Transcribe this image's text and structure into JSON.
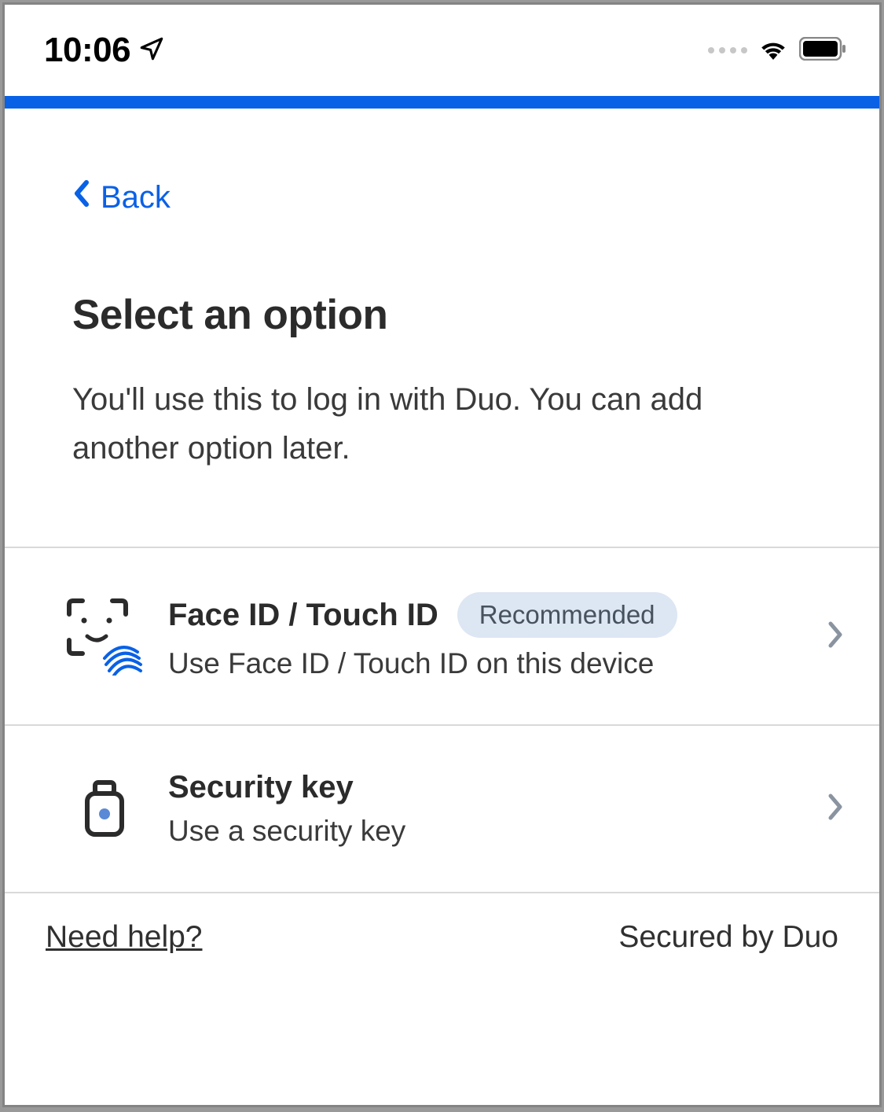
{
  "status_bar": {
    "time": "10:06"
  },
  "nav": {
    "back_label": "Back"
  },
  "header": {
    "title": "Select an option",
    "subtitle": "You'll use this to log in with Duo. You can add another option later."
  },
  "options": [
    {
      "title": "Face ID / Touch ID",
      "badge": "Recommended",
      "description": "Use Face ID / Touch ID on this device"
    },
    {
      "title": "Security key",
      "badge": null,
      "description": "Use a security key"
    }
  ],
  "footer": {
    "help_label": "Need help?",
    "secured_label": "Secured by Duo"
  },
  "colors": {
    "accent": "#0961e6"
  }
}
